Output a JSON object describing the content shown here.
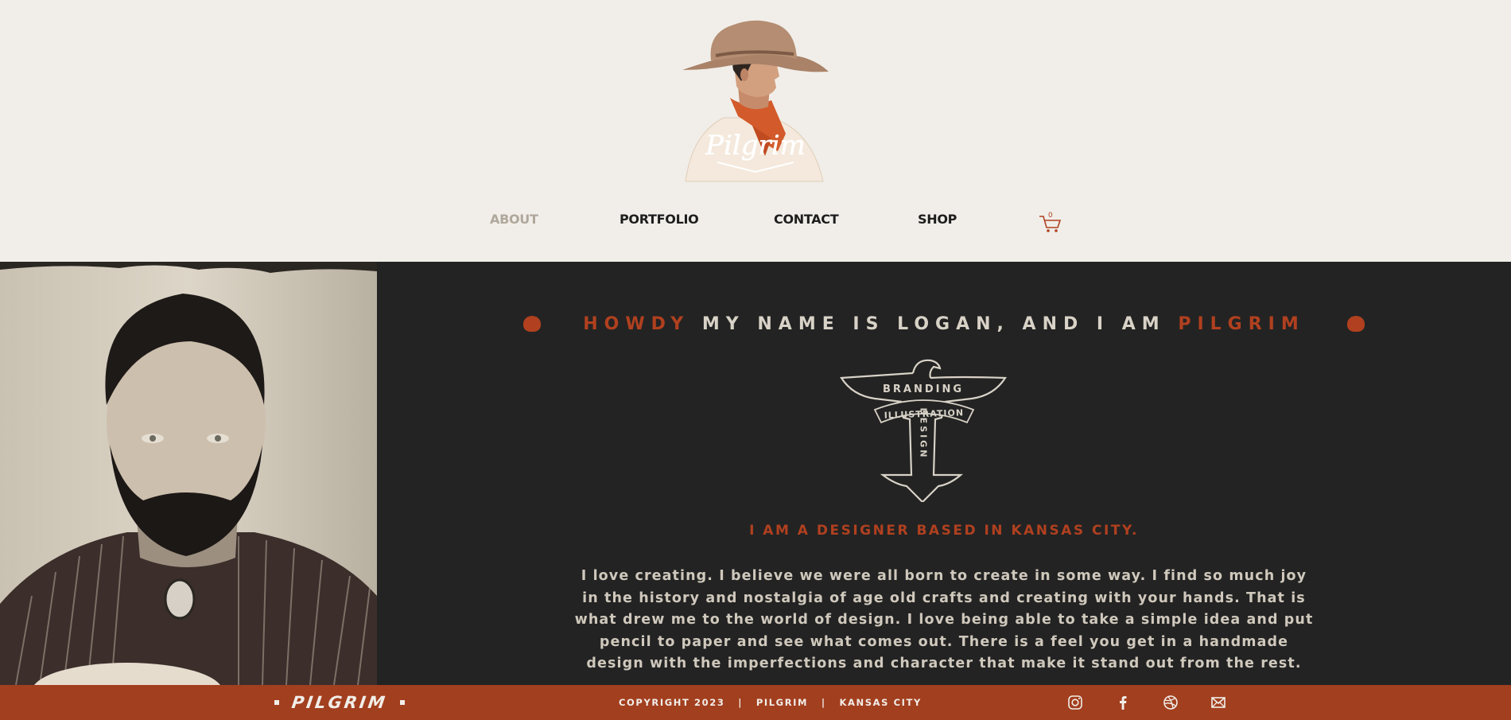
{
  "brand": {
    "logo_script": "Pilgrim"
  },
  "nav": {
    "items": [
      {
        "label": "ABOUT",
        "active": true
      },
      {
        "label": "PORTFOLIO",
        "active": false
      },
      {
        "label": "CONTACT",
        "active": false
      },
      {
        "label": "SHOP",
        "active": false
      }
    ],
    "cart_count": "0"
  },
  "about": {
    "heading_prefix": "HOWDY",
    "heading_middle": "MY NAME IS LOGAN, AND I AM",
    "heading_suffix": "PILGRIM",
    "emblem_words": {
      "top": "BRANDING",
      "band": "ILLUSTRATION",
      "vertical": "DESIGN"
    },
    "subheading": "I AM A DESIGNER BASED IN KANSAS CITY.",
    "body": "I love creating. I believe we were all born to create in some way. I find so much joy in the history and nostalgia of age old crafts and creating with your hands. That is what drew me to the world of design. I love being able to take a simple idea and put pencil to paper and see what comes out. There is a feel you get in a handmade design with the imperfections and character that make it stand out from the rest."
  },
  "footer": {
    "brand": "PILGRIM",
    "copyright": "COPYRIGHT 2023   |   PILGRIM   |   KANSAS CITY",
    "social": [
      "instagram-icon",
      "facebook-icon",
      "dribbble-icon",
      "mail-icon"
    ]
  },
  "colors": {
    "accent": "#b0401f",
    "dark": "#232323",
    "cream": "#f1eee9",
    "footer": "#a23f1f"
  }
}
